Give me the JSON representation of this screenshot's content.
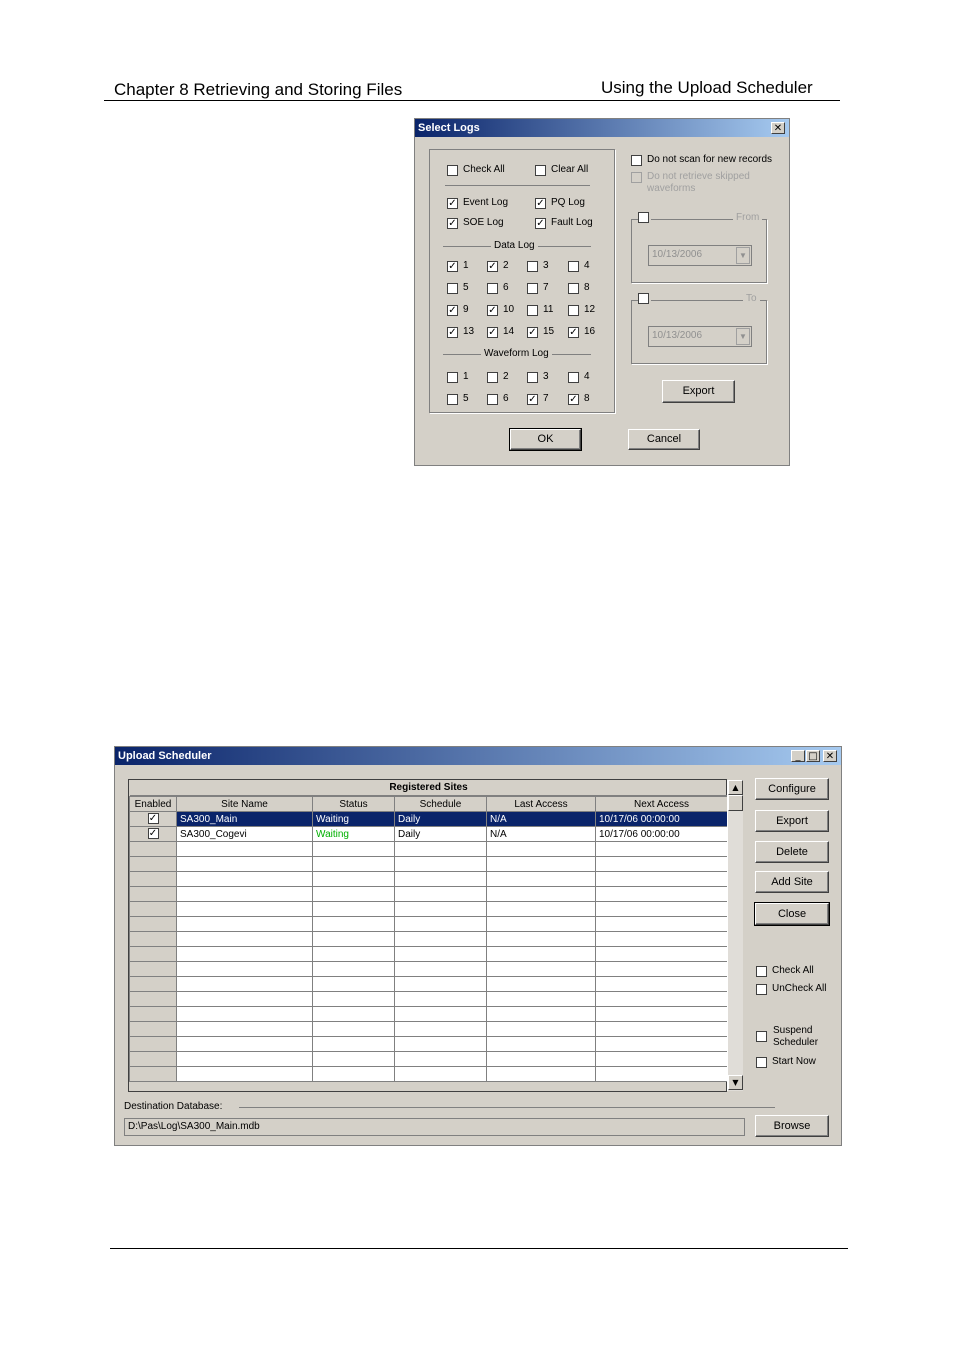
{
  "header": {
    "chapter": "Chapter 8 Retrieving and Storing Files",
    "section": "Using the Upload Scheduler"
  },
  "select_logs": {
    "title": "Select Logs",
    "close_glyph": "✕",
    "check_all": "Check All",
    "clear_all": "Clear All",
    "event_log": "Event Log",
    "pq_log": "PQ Log",
    "soe_log": "SOE Log",
    "fault_log": "Fault Log",
    "data_log_label": "Data Log",
    "waveform_log_label": "Waveform Log",
    "data_log": [
      {
        "label": "1",
        "checked": true
      },
      {
        "label": "2",
        "checked": true
      },
      {
        "label": "3",
        "checked": false
      },
      {
        "label": "4",
        "checked": false
      },
      {
        "label": "5",
        "checked": false
      },
      {
        "label": "6",
        "checked": false
      },
      {
        "label": "7",
        "checked": false
      },
      {
        "label": "8",
        "checked": false
      },
      {
        "label": "9",
        "checked": true
      },
      {
        "label": "10",
        "checked": true
      },
      {
        "label": "11",
        "checked": false
      },
      {
        "label": "12",
        "checked": false
      },
      {
        "label": "13",
        "checked": true
      },
      {
        "label": "14",
        "checked": true
      },
      {
        "label": "15",
        "checked": true
      },
      {
        "label": "16",
        "checked": true
      }
    ],
    "waveform_log": [
      {
        "label": "1",
        "checked": false
      },
      {
        "label": "2",
        "checked": false
      },
      {
        "label": "3",
        "checked": false
      },
      {
        "label": "4",
        "checked": false
      },
      {
        "label": "5",
        "checked": false
      },
      {
        "label": "6",
        "checked": false
      },
      {
        "label": "7",
        "checked": true
      },
      {
        "label": "8",
        "checked": true
      }
    ],
    "no_scan": "Do not scan for new records",
    "no_retrieve_1": "Do not retrieve skipped",
    "no_retrieve_2": "waveforms",
    "from_label": "From",
    "to_label": "To",
    "from_date": "10/13/2006",
    "to_date": "10/13/2006",
    "export": "Export",
    "ok": "OK",
    "cancel": "Cancel"
  },
  "upload_scheduler": {
    "title": "Upload Scheduler",
    "grid_title": "Registered Sites",
    "columns": [
      "Enabled",
      "Site Name",
      "Status",
      "Schedule",
      "Last Access",
      "Next Access"
    ],
    "rows": [
      {
        "enabled": "✓",
        "site": "SA300_Main",
        "status": "Waiting",
        "schedule": "Daily",
        "last": "N/A",
        "next": "10/17/06 00:00:00"
      },
      {
        "enabled": "✓",
        "site": "SA300_Cogevi",
        "status": "Waiting",
        "schedule": "Daily",
        "last": "N/A",
        "next": "10/17/06 00:00:00"
      }
    ],
    "buttons": {
      "configure": "Configure",
      "export": "Export",
      "delete": "Delete",
      "add_site": "Add Site",
      "close": "Close",
      "browse": "Browse"
    },
    "check_all": "Check All",
    "uncheck_all": "UnCheck All",
    "suspend_1": "Suspend",
    "suspend_2": "Scheduler",
    "start_now": "Start Now",
    "dest_label": "Destination Database:",
    "dest_path": "D:\\Pas\\Log\\SA300_Main.mdb"
  }
}
